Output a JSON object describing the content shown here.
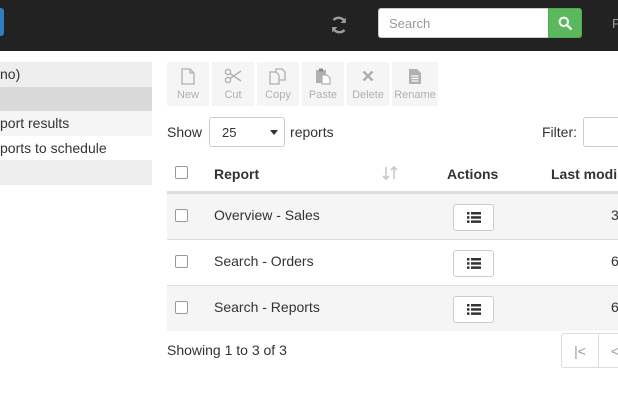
{
  "topbar": {
    "search_placeholder": "Search",
    "right_cut_text": "P"
  },
  "sidebar": {
    "items": [
      {
        "label": "no)"
      },
      {
        "label": ""
      },
      {
        "label": "port results"
      },
      {
        "label": "ports to schedule"
      },
      {
        "label": ""
      }
    ]
  },
  "toolbar": {
    "new_label": "New",
    "cut_label": "Cut",
    "copy_label": "Copy",
    "paste_label": "Paste",
    "delete_label": "Delete",
    "rename_label": "Rename"
  },
  "list_controls": {
    "show_label": "Show",
    "page_size": "25",
    "reports_label": "reports",
    "filter_label": "Filter:"
  },
  "table": {
    "headers": {
      "report": "Report",
      "actions": "Actions",
      "last_modified": "Last modi"
    },
    "rows": [
      {
        "report": "Overview - Sales",
        "date": "3"
      },
      {
        "report": "Search - Orders",
        "date": "6"
      },
      {
        "report": "Search - Reports",
        "date": "6/"
      }
    ]
  },
  "footer": {
    "showing_text": "Showing 1 to 3 of 3",
    "first_page": "|<",
    "prev_page": "<"
  },
  "colors": {
    "topbar": "#222222",
    "search_button": "#5cb85c",
    "toolbar_tile": "#f5f5f5"
  }
}
